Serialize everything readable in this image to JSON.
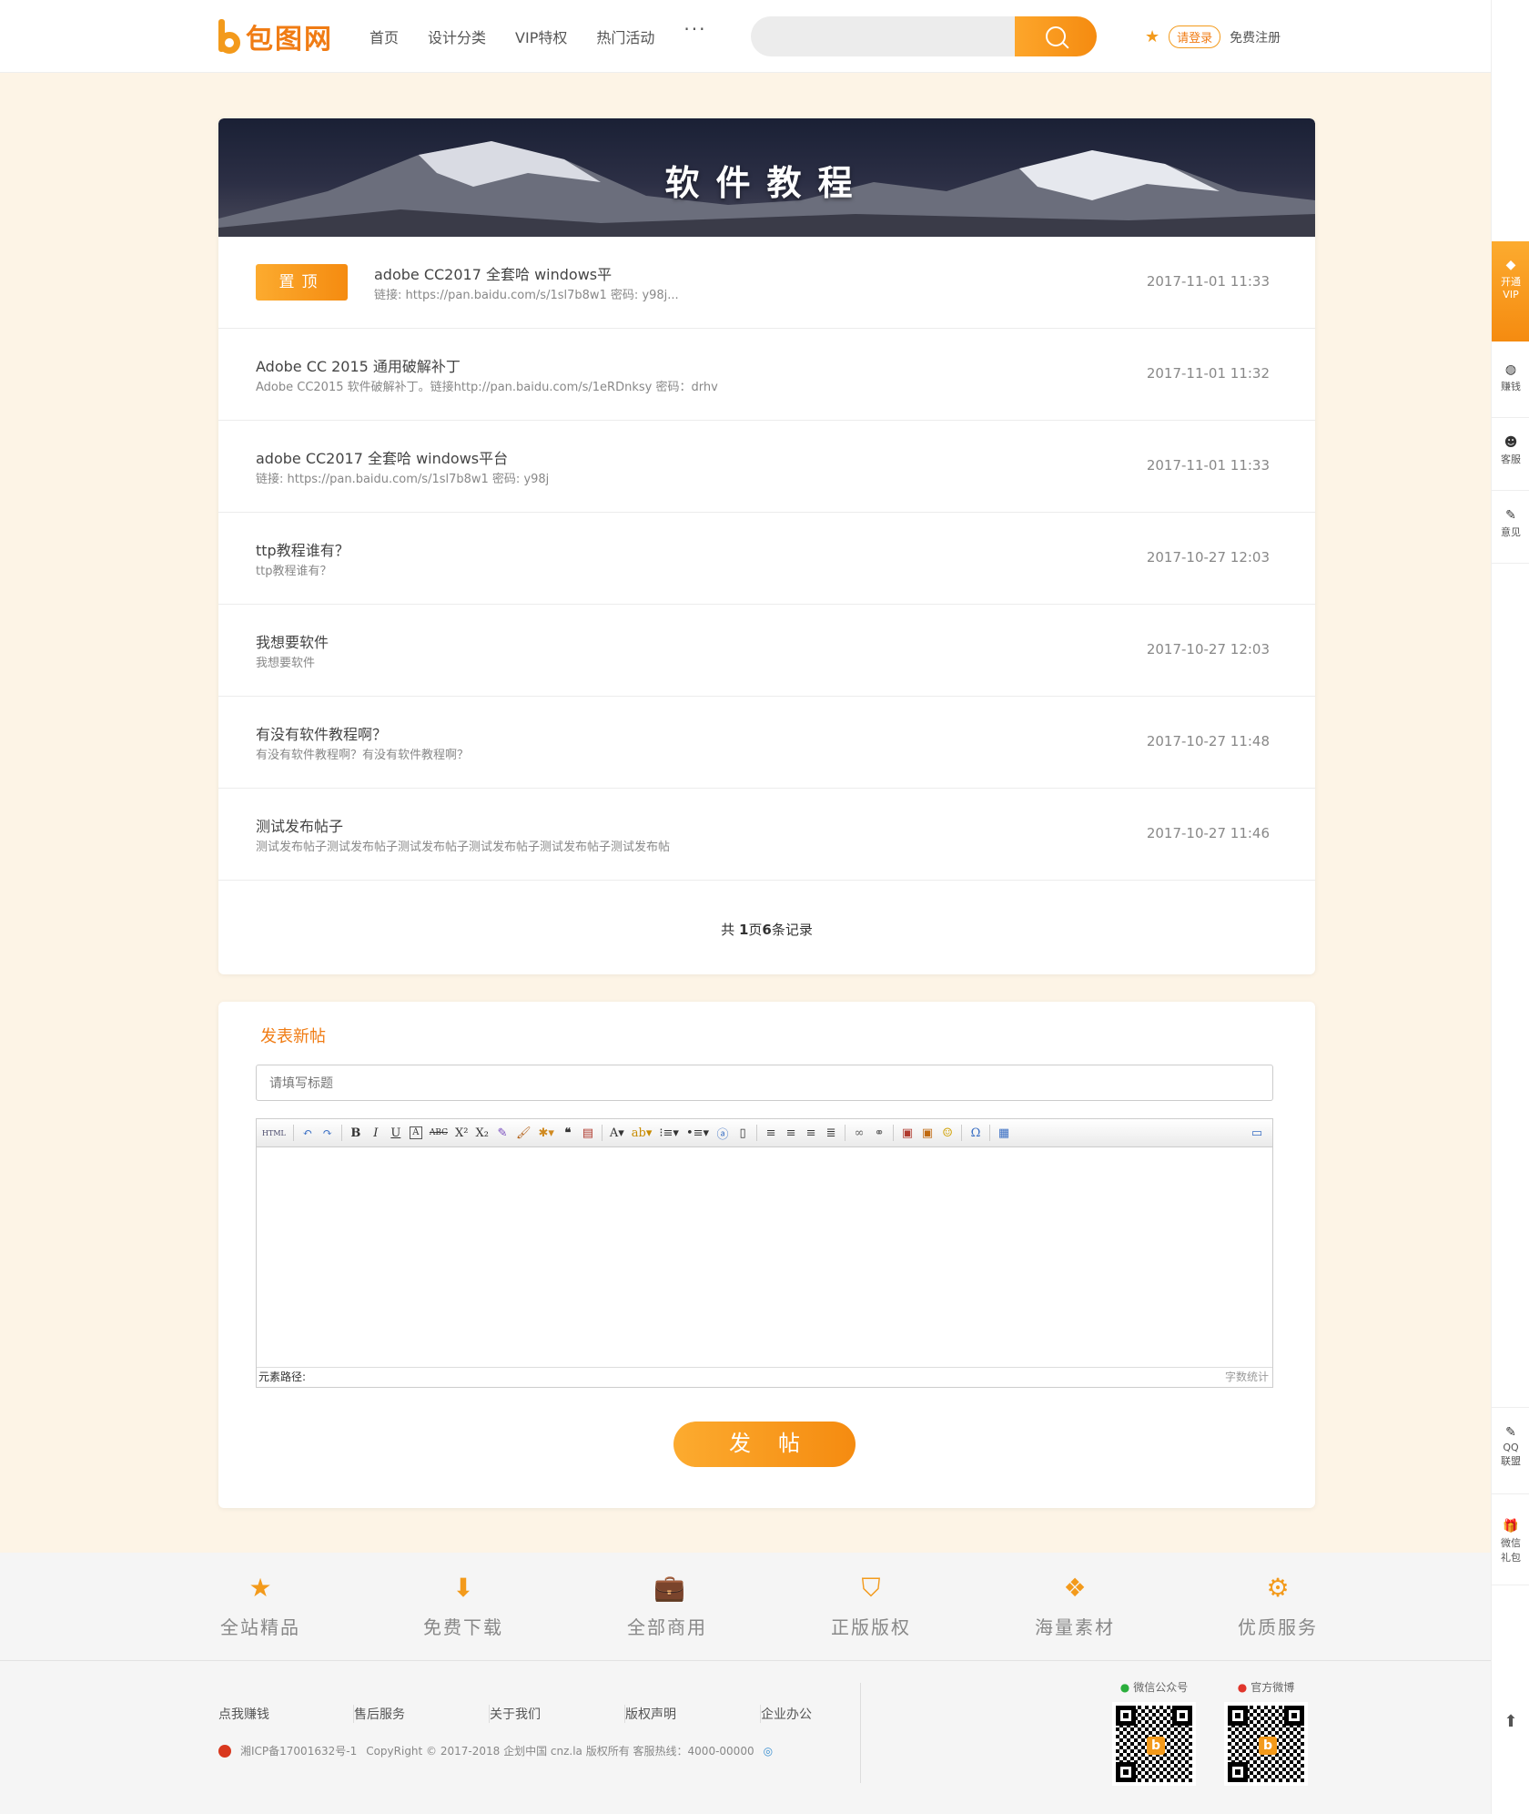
{
  "header": {
    "logo_text": "包图网",
    "nav": [
      "首页",
      "设计分类",
      "VIP特权",
      "热门活动"
    ],
    "more": "···",
    "search_placeholder": "",
    "login": "请登录",
    "register": "免费注册"
  },
  "banner": {
    "title": "软件教程"
  },
  "posts": [
    {
      "pinned": true,
      "badge": "置顶",
      "title": "adobe CC2017 全套哈 windows平",
      "desc": "链接: https://pan.baidu.com/s/1sl7b8w1 密码: y98j...",
      "date": "2017-11-01 11:33"
    },
    {
      "title": "Adobe CC 2015 通用破解补丁",
      "desc": "Adobe CC2015 软件破解补丁。链接http://pan.baidu.com/s/1eRDnksy 密码：drhv",
      "date": "2017-11-01 11:32"
    },
    {
      "title": "adobe CC2017 全套哈 windows平台",
      "desc": "链接: https://pan.baidu.com/s/1sl7b8w1 密码: y98j",
      "date": "2017-11-01 11:33"
    },
    {
      "title": "ttp教程谁有？",
      "desc": "ttp教程谁有？",
      "date": "2017-10-27 12:03"
    },
    {
      "title": "我想要软件",
      "desc": "我想要软件",
      "date": "2017-10-27 12:03"
    },
    {
      "title": "有没有软件教程啊？",
      "desc": "有没有软件教程啊？有没有软件教程啊？",
      "date": "2017-10-27 11:48"
    },
    {
      "title": "测试发布帖子",
      "desc": "测试发布帖子测试发布帖子测试发布帖子测试发布帖子测试发布帖子测试发布帖",
      "date": "2017-10-27 11:46"
    }
  ],
  "pager": {
    "prefix": "共 ",
    "pages": "1",
    "mid": "页",
    "records": "6",
    "suffix": "条记录"
  },
  "post_form": {
    "heading": "发表新帖",
    "title_placeholder": "请填写标题",
    "footer_path": "元素路径:",
    "footer_count": "字数统计",
    "submit": "发帖"
  },
  "features": [
    "全站精品",
    "免费下载",
    "全部商用",
    "正版版权",
    "海量素材",
    "优质服务"
  ],
  "footer": {
    "links": [
      "点我赚钱",
      "售后服务",
      "关于我们",
      "版权声明",
      "企业办公"
    ],
    "icp": "湘ICP备17001632号-1",
    "copyright": "CopyRight © 2017-2018 企划中国 cnz.la 版权所有 客服热线：4000-00000",
    "wechat_label": "微信公众号",
    "weibo_label": "官方微博"
  },
  "sidebar": {
    "vip": [
      "开通",
      "VIP"
    ],
    "earn": "赚钱",
    "service": "客服",
    "feedback": "意见",
    "qq": [
      "QQ",
      "联盟"
    ],
    "wechat_gift": [
      "微信",
      "礼包"
    ]
  },
  "colors": {
    "accent": "#f58b10",
    "accent_light": "#fcab2f",
    "page_bg": "#fdf4e6"
  }
}
